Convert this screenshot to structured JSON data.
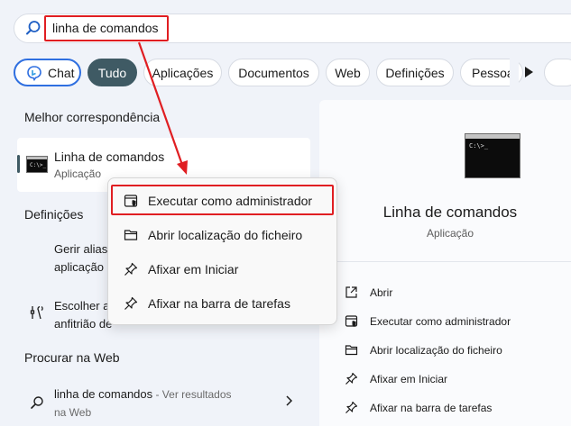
{
  "search": {
    "query": "linha de comandos"
  },
  "filters": [
    "Chat",
    "Tudo",
    "Aplicações",
    "Documentos",
    "Web",
    "Definições",
    "Pessoa"
  ],
  "sections": {
    "best_match": "Melhor correspondência",
    "settings": "Definições",
    "web": "Procurar na Web"
  },
  "best_match": {
    "title": "Linha de comandos",
    "subtitle": "Aplicação"
  },
  "settings_items": [
    {
      "line1": "Gerir alias",
      "line2": "aplicação"
    },
    {
      "line1": "Escolher a",
      "line2": "anfitrião de"
    }
  ],
  "web_item": {
    "query": "linha de comandos",
    "suffix": " - Ver resultados",
    "line2": "na Web"
  },
  "right_panel": {
    "title": "Linha de comandos",
    "subtitle": "Aplicação",
    "actions": [
      "Abrir",
      "Executar como administrador",
      "Abrir localização do ficheiro",
      "Afixar em Iniciar",
      "Afixar na barra de tarefas"
    ]
  },
  "context_menu": [
    "Executar como administrador",
    "Abrir localização do ficheiro",
    "Afixar em Iniciar",
    "Afixar na barra de tarefas"
  ],
  "colors": {
    "highlight": "#e01e22",
    "active_pill": "#3f5a64",
    "chat_border": "#2f6fe0"
  }
}
